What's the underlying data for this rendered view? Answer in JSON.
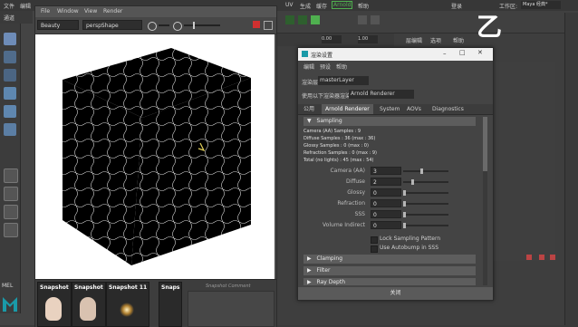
{
  "maya": {
    "menu_left": [
      "文件",
      "编辑"
    ],
    "menu_right": [
      "UV",
      "生成",
      "缓存",
      "Arnold",
      "帮助"
    ],
    "login_label": "登录",
    "workspace_label": "工作区:",
    "workspace_value": "Maya 经典*",
    "panel_label_1": "通道",
    "mel_label": "MEL",
    "timeline_value_1": "0.00",
    "timeline_value_2": "1.00",
    "right_tabs": [
      "层编辑",
      "选项",
      "帮助"
    ],
    "overlay_glyph": "乙"
  },
  "render_view": {
    "menu": [
      "File",
      "Window",
      "View",
      "Render"
    ],
    "renderer_select": "Beauty",
    "camera_select": "perspShape",
    "snapshots": [
      "Snapshot",
      "Snapshot",
      "Snapshot 11",
      "Snaps"
    ],
    "snapshot_comment": "Snapshot Comment"
  },
  "render_settings": {
    "title": "渲染设置",
    "menu": [
      "编辑",
      "预设",
      "帮助"
    ],
    "render_layer_label": "渲染层",
    "render_layer_value": "masterLayer",
    "render_using_label": "使用以下渲染器渲染",
    "render_using_value": "Arnold Renderer",
    "tabs": [
      "公用",
      "Arnold Renderer",
      "System",
      "AOVs",
      "Diagnostics"
    ],
    "sampling_header": "Sampling",
    "stats": [
      "Camera (AA) Samples : 9",
      "Diffuse Samples : 36 (max : 36)",
      "Glossy Samples : 0 (max : 0)",
      "Refraction Samples : 0 (max : 9)",
      "Total (no lights) : 45 (max : 54)"
    ],
    "rows": [
      {
        "label": "Camera (AA)",
        "value": "3",
        "level": 0.4
      },
      {
        "label": "Diffuse",
        "value": "2",
        "level": 0.2
      },
      {
        "label": "Glossy",
        "value": "0",
        "level": 0
      },
      {
        "label": "Refraction",
        "value": "0",
        "level": 0
      },
      {
        "label": "SSS",
        "value": "0",
        "level": 0
      },
      {
        "label": "Volume Indirect",
        "value": "0",
        "level": 0
      }
    ],
    "checks": [
      "Lock Sampling Pattern",
      "Use Autobump in SSS"
    ],
    "sections": [
      "Clamping",
      "Filter",
      "Ray Depth"
    ],
    "close_label": "关闭"
  },
  "colors": {
    "accent_green": "#4fb04f",
    "maya_logo": "#1a9aa8"
  }
}
